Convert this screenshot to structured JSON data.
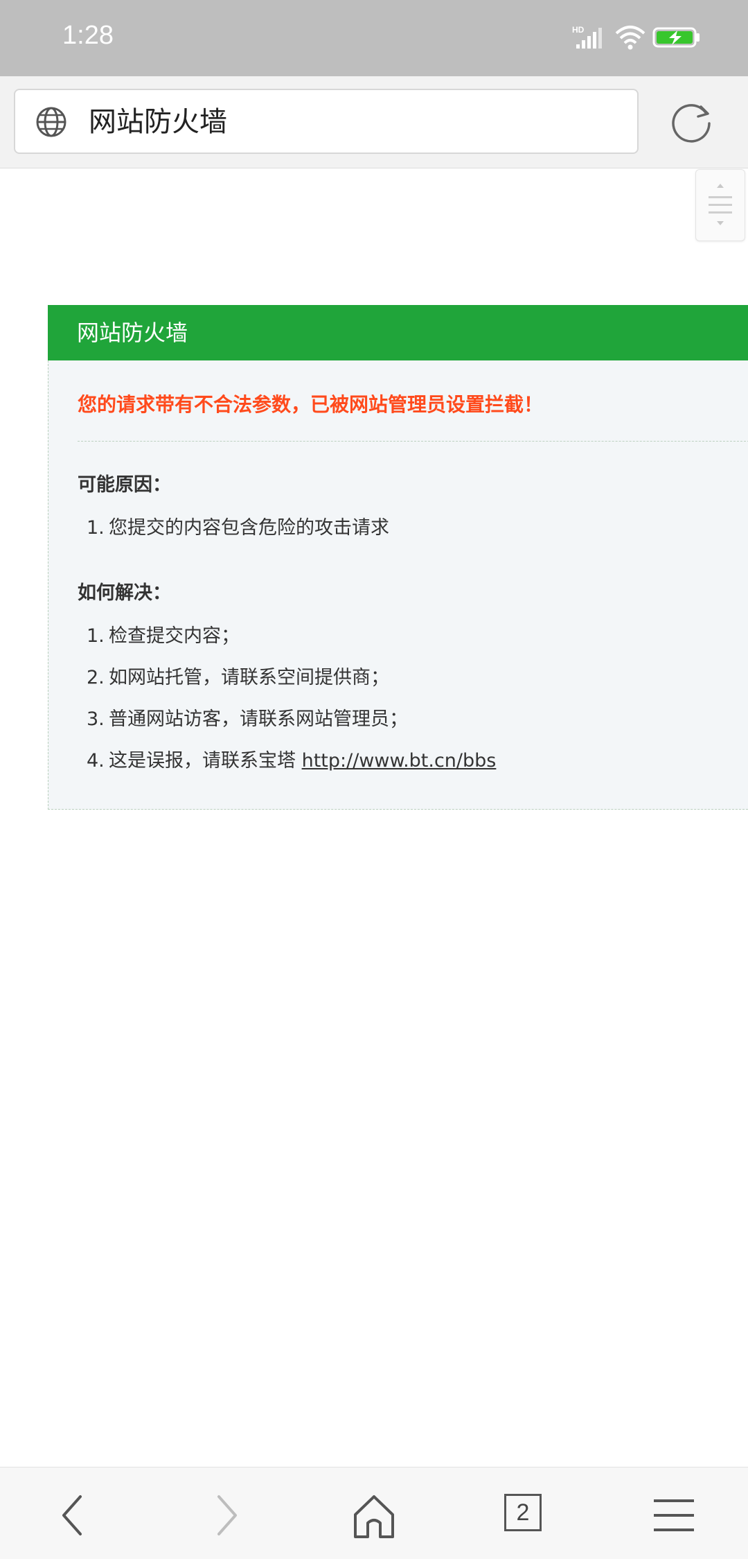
{
  "status_bar": {
    "time": "1:28",
    "network_label": "HD"
  },
  "address_bar": {
    "url_text": "网站防火墙"
  },
  "card": {
    "title": "网站防火墙",
    "warning": "您的请求带有不合法参数，已被网站管理员设置拦截！",
    "reasons_title": "可能原因：",
    "reasons": [
      {
        "num": "1.",
        "text": "您提交的内容包含危险的攻击请求"
      }
    ],
    "solutions_title": "如何解决：",
    "solutions": [
      {
        "num": "1.",
        "text": "检查提交内容；"
      },
      {
        "num": "2.",
        "text": "如网站托管，请联系空间提供商；"
      },
      {
        "num": "3.",
        "text": "普通网站访客，请联系网站管理员；"
      },
      {
        "num": "4.",
        "text": "这是误报，请联系宝塔 ",
        "link": "http://www.bt.cn/bbs"
      }
    ]
  },
  "bottom_nav": {
    "tab_count": "2"
  },
  "colors": {
    "header_green": "#20a53a",
    "warning_red": "#ff4a1c",
    "status_bar": "#bebebe"
  }
}
